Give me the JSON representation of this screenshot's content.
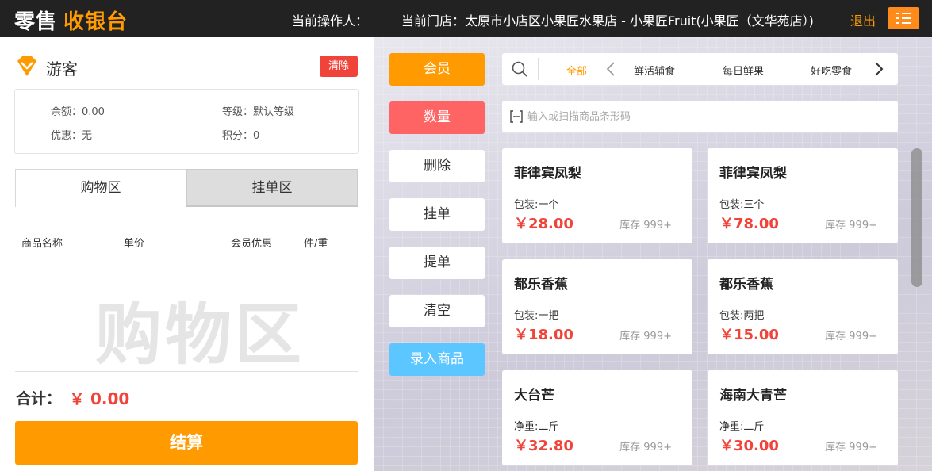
{
  "header": {
    "logo_part1": "零售",
    "logo_part2": "收银台",
    "operator_label": "当前操作人：",
    "store_label": "当前门店：",
    "store_name": "太原市小店区小果匠水果店 - 小果匠Fruit(小果匠（文华苑店）)",
    "logout": "退出",
    "menu_icon": "list-menu-icon"
  },
  "customer": {
    "name": "游客",
    "clear": "清除",
    "icon": "vip-diamond-icon",
    "balance": "余额：0.00",
    "discount": "优惠：无",
    "level": "等级：默认等级",
    "points": "积分：0"
  },
  "cart": {
    "tab_shopping": "购物区",
    "tab_hold": "挂单区",
    "columns": [
      "商品名称",
      "单价",
      "会员优惠",
      "件/重"
    ],
    "watermark": "购物区",
    "total_label": "合计：",
    "total_value": "￥ 0.00",
    "checkout": "结算"
  },
  "actions": [
    "会员",
    "数量",
    "删除",
    "挂单",
    "提单",
    "清空",
    "录入商品"
  ],
  "categories": {
    "items": [
      "全部",
      "鲜活辅食",
      "每日鲜果",
      "好吃零食"
    ],
    "active": "全部"
  },
  "barcode": {
    "placeholder": "输入或扫描商品条形码"
  },
  "products": [
    {
      "name": "菲律宾凤梨",
      "pack": "包装:一个",
      "price": "￥28.00",
      "stock": "库存 999+"
    },
    {
      "name": "菲律宾凤梨",
      "pack": "包装:三个",
      "price": "￥78.00",
      "stock": "库存 999+"
    },
    {
      "name": "都乐香蕉",
      "pack": "包装:一把",
      "price": "￥18.00",
      "stock": "库存 999+"
    },
    {
      "name": "都乐香蕉",
      "pack": "包装:两把",
      "price": "￥15.00",
      "stock": "库存 999+"
    },
    {
      "name": "大台芒",
      "pack": "净重:二斤",
      "price": "￥32.80",
      "stock": "库存 999+"
    },
    {
      "name": "海南大青芒",
      "pack": "净重:二斤",
      "price": "￥30.00",
      "stock": "库存 999+"
    }
  ],
  "colors": {
    "accent": "#ff9a00",
    "danger": "#f0443a",
    "quantity": "#ff6464",
    "add_product": "#5bc6ff",
    "header_bg": "#222222"
  }
}
